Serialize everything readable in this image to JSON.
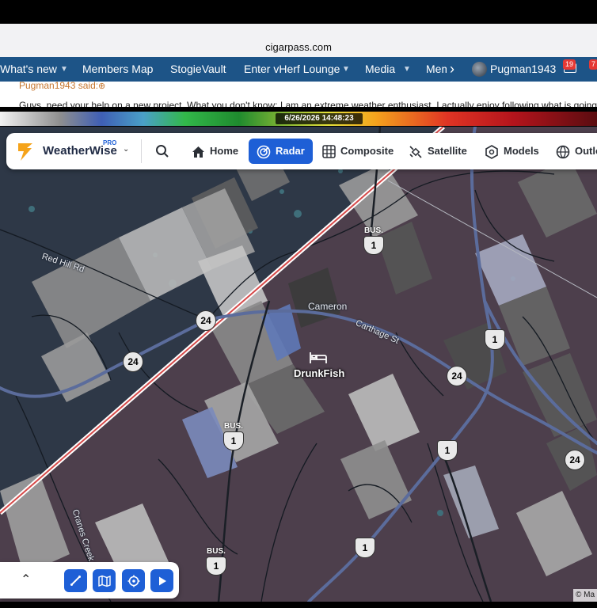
{
  "browser": {
    "url": "cigarpass.com"
  },
  "site_nav": {
    "items": [
      {
        "label": "What's new"
      },
      {
        "label": "Members Map"
      },
      {
        "label": "StogieVault"
      },
      {
        "label": "Enter vHerf Lounge"
      },
      {
        "label": "Media"
      },
      {
        "label": "Mem"
      }
    ],
    "user": {
      "name": "Pugman1943"
    },
    "badges": {
      "inbox": "19",
      "alerts": "7"
    }
  },
  "forum": {
    "quote_author": "Pugman1943 said:",
    "body_text": "Guys, need your help on a new project. What you don't know: I am an extreme weather enthusiast. I actually enjoy following what is going on wh"
  },
  "radar_legend": {
    "timestamp": "6/26/2026 14:48:23"
  },
  "app_toolbar": {
    "brand": "WeatherWise",
    "brand_badge": "PRO",
    "tabs": [
      {
        "label": "Home",
        "icon": "home-icon"
      },
      {
        "label": "Radar",
        "icon": "radar-icon",
        "active": true
      },
      {
        "label": "Composite",
        "icon": "grid-icon"
      },
      {
        "label": "Satellite",
        "icon": "satellite-icon"
      },
      {
        "label": "Models",
        "icon": "models-icon"
      },
      {
        "label": "Outlo",
        "icon": "globe-icon"
      }
    ]
  },
  "map": {
    "places": {
      "cameron": "Cameron",
      "poi": "DrunkFish",
      "red_hill": "Red Hill Rd",
      "carthage": "Carthage St",
      "cranes_creek": "Cranes Creek R"
    },
    "shields": {
      "us1": "1",
      "nc24": "24",
      "bus": "BUS."
    },
    "attribution": "© Ma"
  },
  "colors": {
    "site_nav_bg": "#1d5487",
    "radar_active": "#1e5fd6",
    "brand_accent": "#f5a31a",
    "map_land": "#2e3847",
    "county_shade": "#4d3f4c"
  }
}
